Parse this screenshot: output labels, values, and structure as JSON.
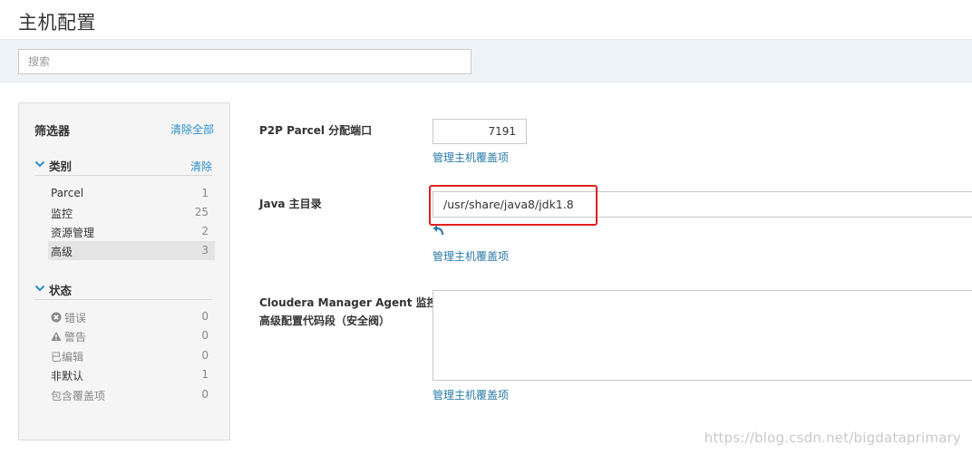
{
  "page": {
    "title": "主机配置"
  },
  "search": {
    "placeholder": "搜索",
    "value": ""
  },
  "filters": {
    "title": "筛选器",
    "clear_all": "清除全部",
    "category": {
      "label": "类别",
      "clear": "清除",
      "items": [
        {
          "name": "Parcel",
          "count": "1",
          "selected": false
        },
        {
          "name": "监控",
          "count": "25",
          "selected": false
        },
        {
          "name": "资源管理",
          "count": "2",
          "selected": false
        },
        {
          "name": "高级",
          "count": "3",
          "selected": true
        }
      ]
    },
    "status": {
      "label": "状态",
      "items": [
        {
          "name": "错误",
          "count": "0",
          "icon": "error-circle-icon"
        },
        {
          "name": "警告",
          "count": "0",
          "icon": "warning-triangle-icon"
        },
        {
          "name": "已编辑",
          "count": "0"
        },
        {
          "name": "非默认",
          "count": "1"
        },
        {
          "name": "包含覆盖项",
          "count": "0"
        }
      ]
    }
  },
  "properties": [
    {
      "label": "P2P Parcel 分配端口",
      "value": "7191",
      "override_link": "管理主机覆盖项"
    },
    {
      "label": "Java 主目录",
      "value": "/usr/share/java8/jdk1.8",
      "override_link": "管理主机覆盖项",
      "undo_icon": "undo-arrow-icon"
    },
    {
      "label_line1": "Cloudera Manager Agent 监控",
      "label_line2": "高级配置代码段（安全阀）",
      "value": "",
      "override_link": "管理主机覆盖项"
    }
  ],
  "colors": {
    "link": "#2a8fc9",
    "highlight": "#e02020",
    "header_bg": "#eef3f7"
  },
  "watermark": "https://blog.csdn.net/bigdataprimary"
}
